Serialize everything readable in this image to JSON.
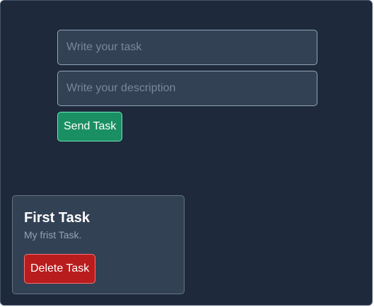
{
  "form": {
    "task_input": {
      "value": "",
      "placeholder": "Write your task"
    },
    "description_input": {
      "value": "",
      "placeholder": "Write your description"
    },
    "send_label": "Send Task"
  },
  "tasks": [
    {
      "title": "First Task",
      "description": "My frist Task.",
      "delete_label": "Delete Task"
    }
  ],
  "colors": {
    "background": "#1e293b",
    "card": "#334155",
    "send_button": "#1a8f64",
    "delete_button": "#b91c1c"
  }
}
